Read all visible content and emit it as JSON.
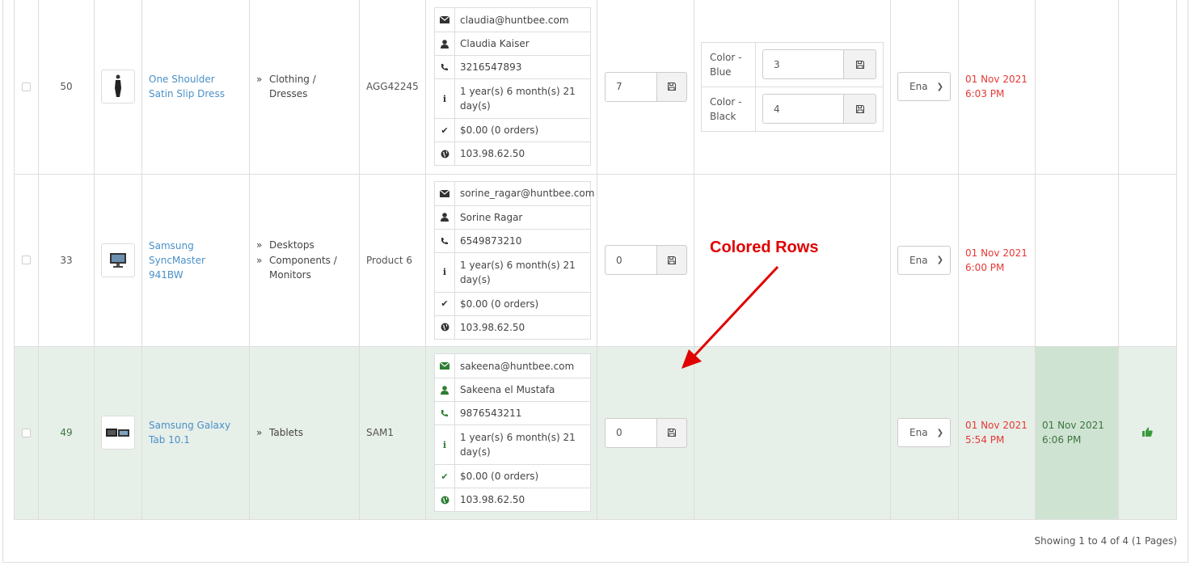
{
  "rows": [
    {
      "id": "50",
      "name": "One Shoulder Satin Slip Dress",
      "categories": [
        "Clothing / Dresses"
      ],
      "model": "AGG42245",
      "customer": {
        "email": "claudia@huntbee.com",
        "name": "Claudia Kaiser",
        "phone": "3216547893",
        "duration": "1 year(s) 6 month(s) 21 day(s)",
        "orders": "$0.00 (0 orders)",
        "ip": "103.98.62.50"
      },
      "quantity": "7",
      "options": [
        {
          "label": "Color - Blue",
          "value": "3"
        },
        {
          "label": "Color - Black",
          "value": "4"
        }
      ],
      "status": "Ena",
      "date_added": "01 Nov 2021 6:03 PM",
      "date_modified": ""
    },
    {
      "id": "33",
      "name": "Samsung SyncMaster 941BW",
      "categories": [
        "Desktops",
        "Components / Monitors"
      ],
      "model": "Product 6",
      "customer": {
        "email": "sorine_ragar@huntbee.com",
        "name": "Sorine Ragar",
        "phone": "6549873210",
        "duration": "1 year(s) 6 month(s) 21 day(s)",
        "orders": "$0.00 (0 orders)",
        "ip": "103.98.62.50"
      },
      "quantity": "0",
      "options": [],
      "status": "Ena",
      "date_added": "01 Nov 2021 6:00 PM",
      "date_modified": ""
    },
    {
      "id": "49",
      "name": "Samsung Galaxy Tab 10.1",
      "categories": [
        "Tablets"
      ],
      "model": "SAM1",
      "customer": {
        "email": "sakeena@huntbee.com",
        "name": "Sakeena el Mustafa",
        "phone": "9876543211",
        "duration": "1 year(s) 6 month(s) 21 day(s)",
        "orders": "$0.00 (0 orders)",
        "ip": "103.98.62.50"
      },
      "quantity": "0",
      "options": [],
      "status": "Ena",
      "date_added": "01 Nov 2021 5:54 PM",
      "date_modified": "01 Nov 2021 6:06 PM",
      "colored": true
    }
  ],
  "category_prefix": "»",
  "pagination_text": "Showing 1 to 4 of 4 (1 Pages)",
  "annotation": "Colored Rows",
  "colors": {
    "colored_row": "#e7efe9",
    "colored_cell": "#cfe3d3",
    "date_red": "#e53935",
    "date_green": "#3c763d",
    "annotation": "#e00000",
    "link": "#4a90c8"
  },
  "icons": {
    "email": "envelope-icon",
    "name": "user-icon",
    "phone": "phone-icon",
    "duration": "info-icon",
    "orders": "check-icon",
    "ip": "globe-icon",
    "save": "floppy-disk-icon",
    "approved": "thumbs-up-icon"
  }
}
